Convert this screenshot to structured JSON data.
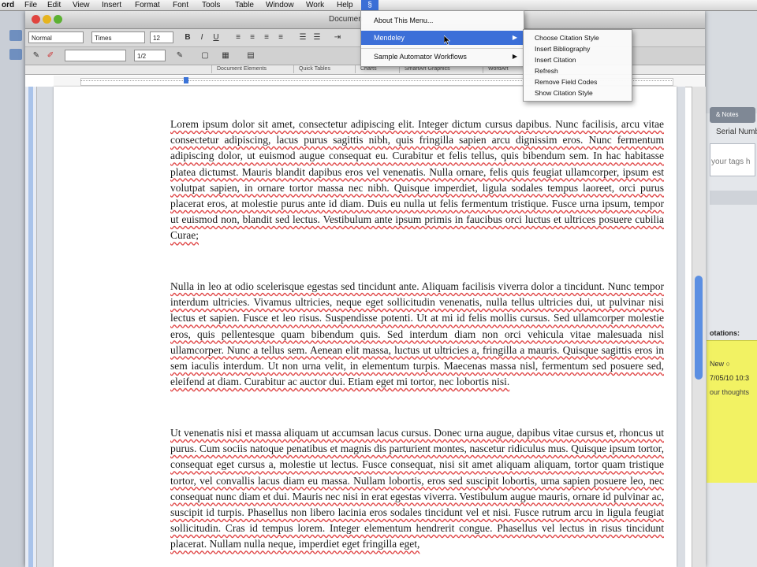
{
  "menubar": {
    "app_name": "ord",
    "items": [
      "File",
      "Edit",
      "View",
      "Insert",
      "Format",
      "Font",
      "Tools",
      "Table",
      "Window",
      "Work",
      "Help"
    ],
    "scripts_icon": "script-icon"
  },
  "window": {
    "doc_name": "Documen"
  },
  "format_toolbar": {
    "style": "Normal",
    "font": "Times",
    "size": "12",
    "bold": "B",
    "italic": "I",
    "underline": "U"
  },
  "standard_toolbar": {
    "line_style": "",
    "line_weight": "1/2"
  },
  "elements_bar": {
    "tabs": [
      "Document Elements",
      "Quick Tables",
      "Charts",
      "SmartArt Graphics",
      "WordArt"
    ]
  },
  "scripts_menu": {
    "items": [
      {
        "label": "About This Menu..."
      },
      {
        "label": "Mendeley"
      },
      {
        "label": "Sample Automator Workflows"
      }
    ]
  },
  "mendeley_submenu": {
    "items": [
      "Choose Citation Style",
      "Insert Bibliography",
      "Insert Citation",
      "Refresh",
      "Remove Field Codes",
      "Show Citation Style"
    ]
  },
  "document": {
    "paragraphs": [
      "Lorem ipsum dolor sit amet, consectetur adipiscing elit. Integer dictum cursus dapibus. Nunc facilisis, arcu vitae consectetur adipiscing, lacus purus sagittis nibh, quis fringilla sapien arcu dignissim eros. Nunc fermentum adipiscing dolor, ut euismod augue consequat eu. Curabitur et felis tellus, quis bibendum sem. In hac habitasse platea dictumst. Mauris blandit dapibus eros vel venenatis. Nulla ornare, felis quis feugiat ullamcorper, ipsum est volutpat sapien, in ornare tortor massa nec nibh. Quisque imperdiet, ligula sodales tempus laoreet, orci purus placerat eros, at molestie purus ante id diam. Duis eu nulla ut felis fermentum tristique. Fusce urna ipsum, tempor ut euismod non, blandit sed lectus. Vestibulum ante ipsum primis in faucibus orci luctus et ultrices posuere cubilia Curae;",
      "Nulla in leo at odio scelerisque egestas sed tincidunt ante. Aliquam facilisis viverra dolor a tincidunt. Nunc tempor interdum ultricies. Vivamus ultricies, neque eget sollicitudin venenatis, nulla tellus ultricies dui, ut pulvinar nisi lectus et sapien. Fusce et leo risus. Suspendisse potenti. Ut at mi id felis mollis cursus. Sed ullamcorper molestie eros, quis pellentesque quam bibendum quis. Sed interdum diam non orci vehicula vitae malesuada nisl ullamcorper. Nunc a tellus sem. Aenean elit massa, luctus ut ultricies a, fringilla a mauris. Quisque sagittis eros in sem iaculis interdum. Ut non urna velit, in elementum turpis. Maecenas massa nisl, fermentum sed posuere sed, eleifend at diam. Curabitur ac auctor dui. Etiam eget mi tortor, nec lobortis nisi.",
      "Ut venenatis nisi et massa aliquam ut accumsan lacus cursus. Donec urna augue, dapibus vitae cursus et, rhoncus ut purus. Cum sociis natoque penatibus et magnis dis parturient montes, nascetur ridiculus mus. Quisque ipsum tortor, consequat eget cursus a, molestie ut lectus. Fusce consequat, nisi sit amet aliquam aliquam, tortor quam tristique tortor, vel convallis lacus diam eu massa. Nullam lobortis, eros sed suscipit lobortis, urna sapien posuere leo, nec consequat nunc diam et dui. Mauris nec nisi in erat egestas viverra. Vestibulum augue mauris, ornare id pulvinar ac, suscipit id turpis. Phasellus non libero lacinia eros sodales tincidunt vel et nisi. Fusce rutrum arcu in ligula feugiat sollicitudin. Cras id tempus lorem. Integer elementum hendrerit congue. Phasellus vel lectus in risus tincidunt placerat. Nullam nulla neque, imperdiet eget fringilla eget,"
    ]
  },
  "side_panel": {
    "tab_label": "& Notes",
    "line1": "Serial Number",
    "tags_placeholder": "your tags h",
    "annotations_label": "otations:",
    "note_new": "New",
    "note_date": "7/05/10 10:3",
    "note_text": "our thoughts"
  },
  "colors": {
    "menu_highlight": "#3c6fd8",
    "note_yellow": "#f2f263",
    "spell_underline": "#e04848"
  }
}
